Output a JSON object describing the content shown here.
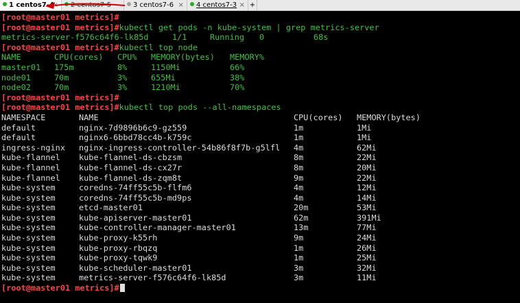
{
  "tabs": [
    {
      "label": "1 centos7-4",
      "dot_color": "#20b020"
    },
    {
      "label": "2 centos7-5",
      "dot_color": "#20b020"
    },
    {
      "label": "3 centos7-6",
      "dot_color": "#a0a0a0"
    },
    {
      "label": "4 centos7-3",
      "dot_color": "#20b020"
    }
  ],
  "new_tab_label": "+",
  "prompt": "[root@master01 metrics]#",
  "commands": {
    "get_pods": "kubectl get pods -n kube-system | grep metrics-server",
    "top_node": "kubectl top node",
    "top_pods": "kubectl top pods --all-namespaces"
  },
  "pod_result": [
    "metrics-server-f576c64f6-lk85d",
    "1/1",
    "Running",
    "0",
    "68s"
  ],
  "node_table": {
    "headers": [
      "NAME",
      "CPU(cores)",
      "CPU%",
      "MEMORY(bytes)",
      "MEMORY%"
    ],
    "rows": [
      [
        "master01",
        "175m",
        "8%",
        "1150Mi",
        "66%"
      ],
      [
        "node01",
        "70m",
        "3%",
        "655Mi",
        "38%"
      ],
      [
        "node02",
        "70m",
        "3%",
        "1210Mi",
        "70%"
      ]
    ]
  },
  "pods_table": {
    "headers": [
      "NAMESPACE",
      "NAME",
      "CPU(cores)",
      "MEMORY(bytes)"
    ],
    "rows": [
      [
        "default",
        "nginx-7d9896b6c9-gz559",
        "1m",
        "1Mi"
      ],
      [
        "default",
        "nginx6-6bbd78cc4b-k759c",
        "1m",
        "1Mi"
      ],
      [
        "ingress-nginx",
        "nginx-ingress-controller-54b86f8f7b-g5lfl",
        "4m",
        "62Mi"
      ],
      [
        "kube-flannel",
        "kube-flannel-ds-cbzsm",
        "8m",
        "22Mi"
      ],
      [
        "kube-flannel",
        "kube-flannel-ds-cx27r",
        "8m",
        "20Mi"
      ],
      [
        "kube-flannel",
        "kube-flannel-ds-zqm8t",
        "9m",
        "22Mi"
      ],
      [
        "kube-system",
        "coredns-74ff55c5b-flfm6",
        "4m",
        "12Mi"
      ],
      [
        "kube-system",
        "coredns-74ff55c5b-md9ps",
        "4m",
        "14Mi"
      ],
      [
        "kube-system",
        "etcd-master01",
        "20m",
        "53Mi"
      ],
      [
        "kube-system",
        "kube-apiserver-master01",
        "62m",
        "391Mi"
      ],
      [
        "kube-system",
        "kube-controller-manager-master01",
        "13m",
        "77Mi"
      ],
      [
        "kube-system",
        "kube-proxy-k55rh",
        "9m",
        "24Mi"
      ],
      [
        "kube-system",
        "kube-proxy-rbqzq",
        "1m",
        "26Mi"
      ],
      [
        "kube-system",
        "kube-proxy-tqwk9",
        "1m",
        "25Mi"
      ],
      [
        "kube-system",
        "kube-scheduler-master01",
        "3m",
        "32Mi"
      ],
      [
        "kube-system",
        "metrics-server-f576c64f6-lk85d",
        "3m",
        "11Mi"
      ]
    ]
  },
  "colors": {
    "background": "#000000",
    "prompt": "#ff4242",
    "command": "#3ec23e",
    "output": "#dcdcdc",
    "annotation_arrow": "#d00000"
  }
}
